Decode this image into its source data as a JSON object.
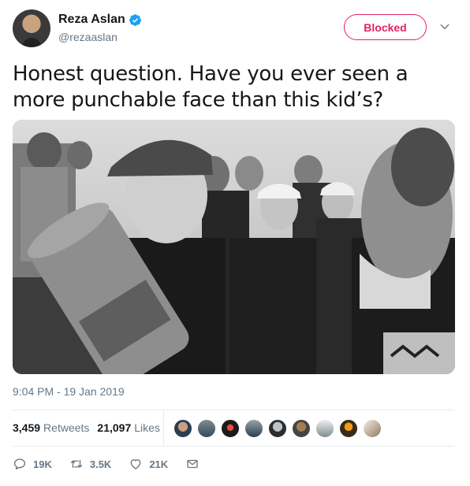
{
  "author": {
    "name": "Reza Aslan",
    "handle": "@rezaaslan",
    "verified_icon": "verified-badge-icon",
    "avatar_icon": "profile-avatar"
  },
  "follow_button": {
    "label": "Blocked",
    "color": "#e0245e"
  },
  "tweet": {
    "text": "Honest question. Have you ever seen a more punchable face than this kid’s?",
    "timestamp": "9:04 PM - 19 Jan 2019"
  },
  "stats": {
    "retweets_count": "3,459",
    "retweets_label": "Retweets",
    "likes_count": "21,097",
    "likes_label": "Likes"
  },
  "actions": {
    "reply_count": "19K",
    "retweet_count": "3.5K",
    "like_count": "21K"
  },
  "colors": {
    "accent": "#1da1f2",
    "muted_text": "#657786",
    "blocked": "#e0245e"
  }
}
